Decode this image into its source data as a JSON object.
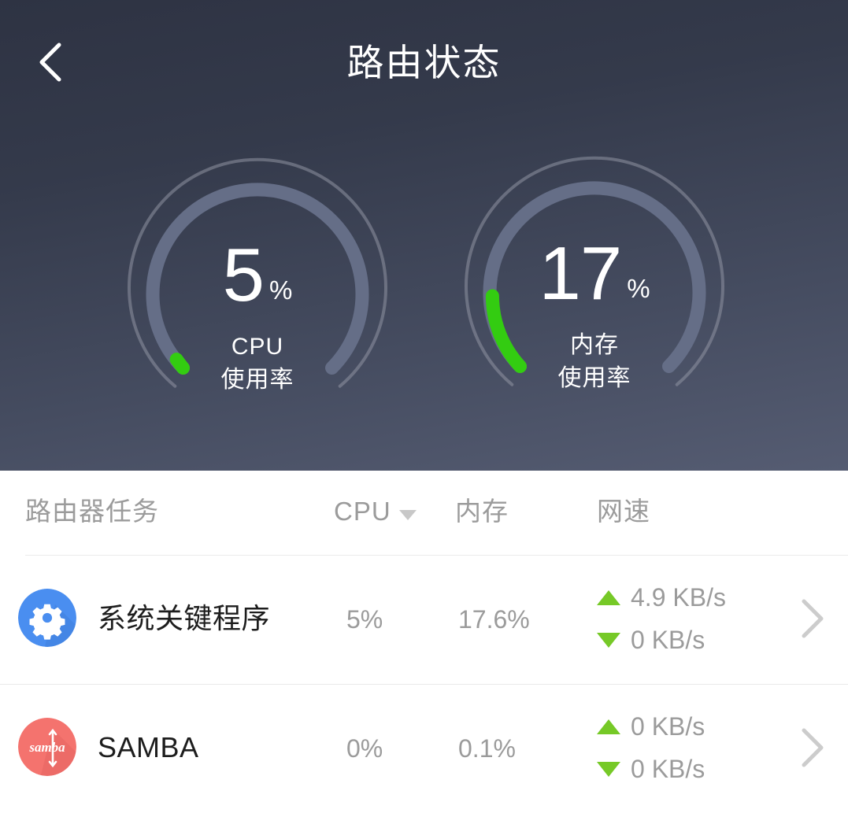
{
  "header": {
    "title": "路由状态",
    "back_icon": "chevron-left-icon"
  },
  "gauges": [
    {
      "id": "cpu",
      "value": 5,
      "value_text": "5",
      "unit": "%",
      "label_line1": "CPU",
      "label_line2": "使用率",
      "arc_color": "#33cc11",
      "track_color": "#656e87",
      "outer_ring_color": "#8a8f9e"
    },
    {
      "id": "memory",
      "value": 17,
      "value_text": "17",
      "unit": "%",
      "label_line1": "内存",
      "label_line2": "使用率",
      "arc_color": "#33cc11",
      "track_color": "#656e87",
      "outer_ring_color": "#8a8f9e"
    }
  ],
  "table": {
    "columns": {
      "task": "路由器任务",
      "cpu": "CPU",
      "memory": "内存",
      "network": "网速"
    },
    "sort": {
      "column": "CPU",
      "direction": "desc",
      "icon": "caret-down-icon"
    },
    "rows": [
      {
        "icon": "gear-icon",
        "icon_bg": "#4a8ef0",
        "name": "系统关键程序",
        "cpu": "5%",
        "memory": "17.6%",
        "upload": "4.9 KB/s",
        "download": "0 KB/s",
        "chevron": "chevron-right-icon"
      },
      {
        "icon": "samba-icon",
        "icon_bg": "#f4736e",
        "icon_text": "samba",
        "name": "SAMBA",
        "cpu": "0%",
        "memory": "0.1%",
        "upload": "0 KB/s",
        "download": "0 KB/s",
        "chevron": "chevron-right-icon"
      }
    ]
  },
  "colors": {
    "hero_top": "#2e3343",
    "hero_bottom": "#555c72",
    "accent_green": "#33cc11",
    "arrow_green": "#76c927",
    "muted_text": "#9b9b9b",
    "chevron": "#cccccc"
  }
}
